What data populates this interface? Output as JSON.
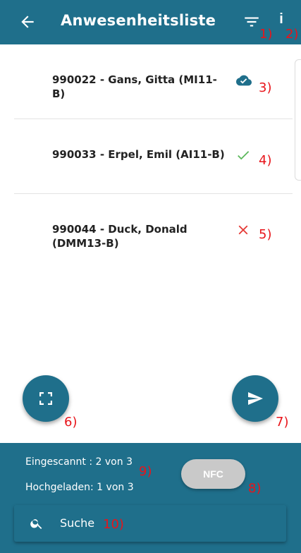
{
  "header": {
    "title": "Anwesenheitsliste",
    "back_icon": "arrow-left-icon",
    "filter_icon": "filter-icon",
    "info_label": "i"
  },
  "annotations": {
    "a1": "1)",
    "a2": "2)",
    "a3": "3)",
    "a4": "4)",
    "a5": "5)",
    "a6": "6)",
    "a7": "7)",
    "a8": "8)",
    "a9": "9)",
    "a10": "10)"
  },
  "students": [
    {
      "label": "990022 - Gans, Gitta (MI11-B)",
      "status": "uploaded",
      "status_icon": "cloud-done-icon"
    },
    {
      "label": "990033 - Erpel, Emil (AI11-B)",
      "status": "scanned",
      "status_icon": "check-icon"
    },
    {
      "label": "990044 - Duck, Donald (DMM13-B)",
      "status": "missing",
      "status_icon": "close-icon"
    }
  ],
  "actions": {
    "scan_icon": "scan-frame-icon",
    "send_icon": "send-icon",
    "nfc_label": "NFC"
  },
  "stats": {
    "scanned": "Eingescannt : 2 von 3",
    "uploaded": "Hochgeladen: 1 von 3"
  },
  "search": {
    "placeholder": "Suche",
    "icon": "search-icon"
  },
  "colors": {
    "primary": "#1f6f8b",
    "annotation": "#e8141a",
    "check": "#5cb85c",
    "cross": "#e53935"
  }
}
